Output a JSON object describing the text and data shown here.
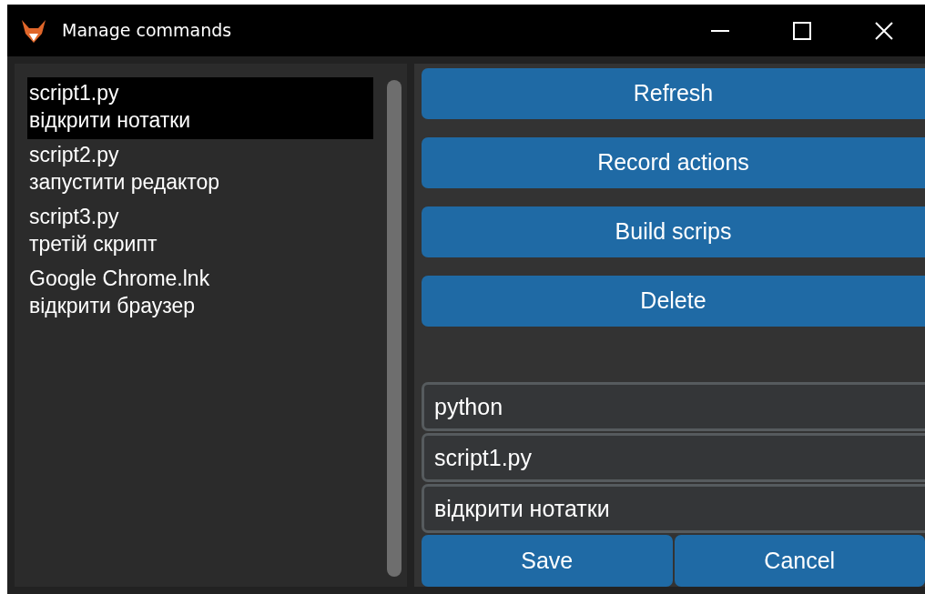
{
  "window": {
    "title": "Manage commands"
  },
  "commands": [
    {
      "file": "script1.py",
      "description": "відкрити нотатки",
      "selected": true
    },
    {
      "file": "script2.py",
      "description": "запустити редактор",
      "selected": false
    },
    {
      "file": "script3.py",
      "description": "третій скрипт",
      "selected": false
    },
    {
      "file": "Google Chrome.lnk",
      "description": "відкрити браузер",
      "selected": false
    }
  ],
  "actions": [
    "Refresh",
    "Record actions",
    "Build scrips",
    "Delete"
  ],
  "fields": [
    {
      "value": "python"
    },
    {
      "value": "script1.py"
    },
    {
      "value": "відкрити нотатки"
    }
  ],
  "buttons": [
    "Save",
    "Cancel"
  ]
}
